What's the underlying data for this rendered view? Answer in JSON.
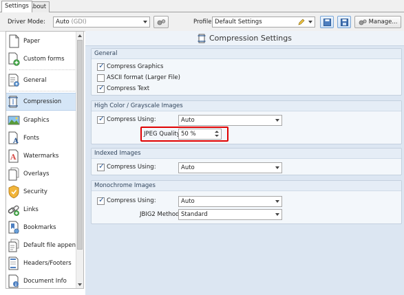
{
  "tabs": [
    {
      "label": "Settings",
      "active": true
    },
    {
      "label": "About",
      "active": false
    }
  ],
  "toolbar": {
    "driver_mode_label": "Driver Mode:",
    "driver_mode_value": "Auto",
    "driver_mode_hint": "(GDI)",
    "profile_label": "Profile:",
    "profile_value": "Default Settings",
    "manage_label": "Manage..."
  },
  "sidebar": {
    "items": [
      {
        "label": "Paper",
        "icon": "paper-icon"
      },
      {
        "label": "Custom forms",
        "icon": "custom-forms-icon"
      },
      {
        "label": "General",
        "icon": "general-settings-icon"
      },
      {
        "label": "Compression",
        "icon": "compression-icon",
        "selected": true
      },
      {
        "label": "Graphics",
        "icon": "graphics-icon"
      },
      {
        "label": "Fonts",
        "icon": "fonts-icon"
      },
      {
        "label": "Watermarks",
        "icon": "watermarks-icon"
      },
      {
        "label": "Overlays",
        "icon": "overlays-icon"
      },
      {
        "label": "Security",
        "icon": "security-shield-icon"
      },
      {
        "label": "Links",
        "icon": "links-icon"
      },
      {
        "label": "Bookmarks",
        "icon": "bookmarks-icon"
      },
      {
        "label": "Default file append",
        "icon": "file-append-icon"
      },
      {
        "label": "Headers/Footers",
        "icon": "headers-footers-icon"
      },
      {
        "label": "Document Info",
        "icon": "document-info-icon"
      }
    ]
  },
  "main": {
    "title": "Compression Settings",
    "general": {
      "title": "General",
      "options": [
        {
          "label": "Compress Graphics",
          "checked": true
        },
        {
          "label": "ASCII format (Larger File)",
          "checked": false
        },
        {
          "label": "Compress Text",
          "checked": true
        }
      ]
    },
    "high_color": {
      "title": "High Color / Grayscale Images",
      "compress_label": "Compress Using:",
      "compress_checked": true,
      "compress_value": "Auto",
      "jpeg_label": "JPEG Quality:",
      "jpeg_value": "50 %"
    },
    "indexed": {
      "title": "Indexed Images",
      "compress_label": "Compress Using:",
      "compress_checked": true,
      "compress_value": "Auto"
    },
    "monochrome": {
      "title": "Monochrome Images",
      "compress_label": "Compress Using:",
      "compress_checked": true,
      "compress_value": "Auto",
      "jbig2_label": "JBIG2 Method:",
      "jbig2_value": "Standard"
    }
  },
  "colors": {
    "highlight": "#e00000",
    "selection": "#d5e6f7",
    "panel_bg": "#dce6f2",
    "check": "#2a5a9a"
  }
}
